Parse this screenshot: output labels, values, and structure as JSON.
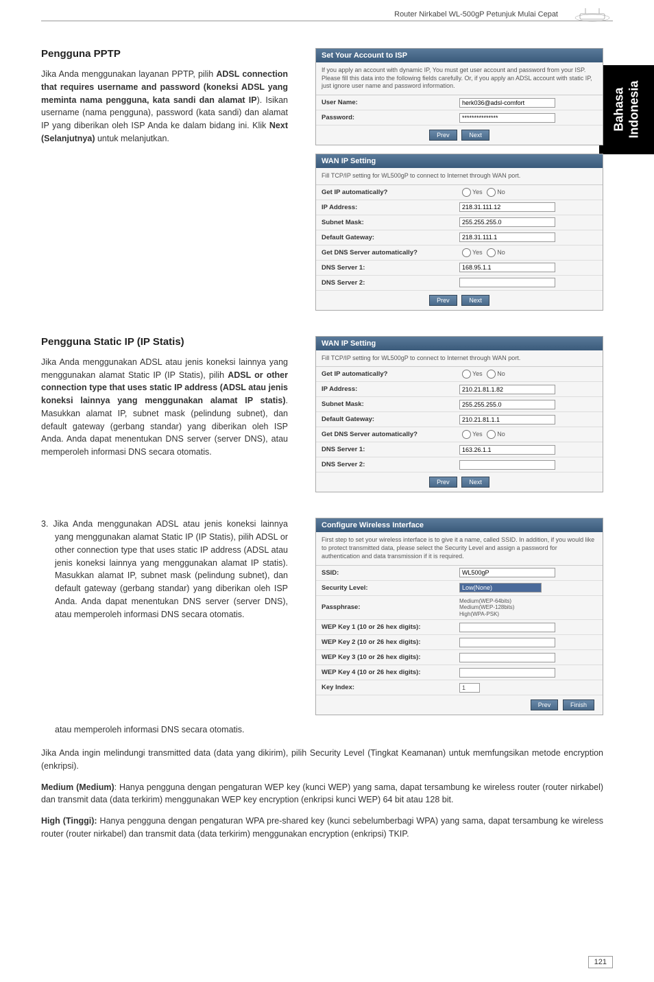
{
  "header": {
    "title": "Router Nirkabel WL-500gP    Petunjuk Mulai Cepat"
  },
  "sideTab": {
    "line1": "Bahasa",
    "line2": "Indonesia"
  },
  "section1": {
    "heading": "Pengguna PPTP",
    "body": "Jika Anda menggunakan layanan PPTP, pilih ADSL connection that requires username and password (koneksi ADSL yang meminta nama pengguna, kata sandi dan alamat IP). Isikan username (nama pengguna), password (kata sandi) dan alamat IP yang diberikan oleh ISP Anda ke dalam bidang ini. Klik Next (Selanjutnya) untuk melanjutkan."
  },
  "panel1": {
    "title": "Set Your Account to ISP",
    "desc": "If you apply an account with dynamic IP, You must get user account and password from your ISP. Please fill this data into the following fields carefully. Or, if you apply an ADSL account with static IP, just ignore user name and password information.",
    "userNameLabel": "User Name:",
    "userNameValue": "herk036@adsl-comfort",
    "passwordLabel": "Password:",
    "passwordValue": "***************",
    "btnPrev": "Prev",
    "btnNext": "Next"
  },
  "panel2": {
    "title": "WAN IP Setting",
    "desc": "Fill TCP/IP setting for WL500gP to connect to Internet through WAN port.",
    "rows": {
      "getIpLabel": "Get IP automatically?",
      "getIpYes": "Yes",
      "getIpNo": "No",
      "ipAddressLabel": "IP Address:",
      "ipAddressValue": "218.31.111.12",
      "subnetLabel": "Subnet Mask:",
      "subnetValue": "255.255.255.0",
      "gatewayLabel": "Default Gateway:",
      "gatewayValue": "218.31.111.1",
      "getDnsLabel": "Get DNS Server automatically?",
      "getDnsYes": "Yes",
      "getDnsNo": "No",
      "dns1Label": "DNS Server 1:",
      "dns1Value": "168.95.1.1",
      "dns2Label": "DNS Server 2:",
      "dns2Value": ""
    },
    "btnPrev": "Prev",
    "btnNext": "Next"
  },
  "section2": {
    "heading": "Pengguna Static IP (IP Statis)",
    "body": "Jika Anda menggunakan ADSL atau jenis koneksi lainnya yang menggunakan alamat Static IP (IP Statis), pilih ADSL or other connection type that uses static IP address (ADSL atau jenis koneksi lainnya yang menggunakan alamat IP statis). Masukkan alamat IP, subnet mask (pelindung subnet), dan default gateway (gerbang standar) yang diberikan oleh ISP Anda. Anda dapat menentukan DNS server (server DNS), atau memperoleh informasi DNS secara otomatis."
  },
  "panel3": {
    "title": "WAN IP Setting",
    "desc": "Fill TCP/IP setting for WL500gP to connect to Internet through WAN port.",
    "rows": {
      "getIpLabel": "Get IP automatically?",
      "getIpYes": "Yes",
      "getIpNo": "No",
      "ipAddressLabel": "IP Address:",
      "ipAddressValue": "210.21.81.1.82",
      "subnetLabel": "Subnet Mask:",
      "subnetValue": "255.255.255.0",
      "gatewayLabel": "Default Gateway:",
      "gatewayValue": "210.21.81.1.1",
      "getDnsLabel": "Get DNS Server automatically?",
      "getDnsYes": "Yes",
      "getDnsNo": "No",
      "dns1Label": "DNS Server 1:",
      "dns1Value": "163.26.1.1",
      "dns2Label": "DNS Server 2:",
      "dns2Value": ""
    },
    "btnPrev": "Prev",
    "btnNext": "Next"
  },
  "item3": {
    "body": "3.  Jika Anda menggunakan ADSL atau jenis koneksi lainnya yang menggunakan alamat Static IP (IP Statis), pilih ADSL or other connection type that uses static IP address (ADSL atau jenis koneksi lainnya yang menggunakan alamat IP statis). Masukkan alamat IP, subnet mask (pelindung subnet), dan default gateway (gerbang standar) yang diberikan oleh ISP Anda. Anda dapat menentukan DNS server (server DNS), atau memperoleh informasi DNS secara otomatis.",
    "tail": "atau memperoleh informasi DNS secara otomatis."
  },
  "panel4": {
    "title": "Configure Wireless Interface",
    "desc": "First step to set your wireless interface is to give it a name, called SSID. In addition, if you would like to protect transmitted data, please select the Security Level and assign a password for authentication and data transmission if it is required.",
    "rows": {
      "ssidLabel": "SSID:",
      "ssidValue": "WL500gP",
      "secLabel": "Security Level:",
      "secValue": "Low(None)",
      "passLabel": "Passphrase:",
      "passValue": "Medium(WEP-64bits)",
      "passValue2": "Medium(WEP-128bits)",
      "passValue3": "High(WPA-PSK)",
      "wep1Label": "WEP Key 1 (10 or 26 hex digits):",
      "wep2Label": "WEP Key 2 (10 or 26 hex digits):",
      "wep3Label": "WEP Key 3 (10 or 26 hex digits):",
      "wep4Label": "WEP Key 4 (10 or 26 hex digits):",
      "keyIndexLabel": "Key Index:",
      "keyIndexValue": "1"
    },
    "btnPrev": "Prev",
    "btnFinish": "Finish"
  },
  "bottomText": {
    "p1": "Jika Anda ingin melindungi transmitted data (data yang dikirim), pilih Security Level (Tingkat Keamanan) untuk memfungsikan metode encryption (enkripsi).",
    "p2a": "Medium (Medium)",
    "p2b": ": Hanya pengguna dengan pengaturan WEP key (kunci WEP) yang sama, dapat tersambung ke wireless router (router nirkabel) dan transmit data (data terkirim) menggunakan WEP key encryption (enkripsi kunci WEP) 64 bit atau 128 bit.",
    "p3a": "High (Tinggi):",
    "p3b": " Hanya pengguna dengan pengaturan WPA pre-shared key (kunci sebelumberbagi WPA) yang sama, dapat tersambung ke wireless router (router nirkabel) dan transmit data (data terkirim) menggunakan encryption (enkripsi) TKIP."
  },
  "pageNumber": "121"
}
